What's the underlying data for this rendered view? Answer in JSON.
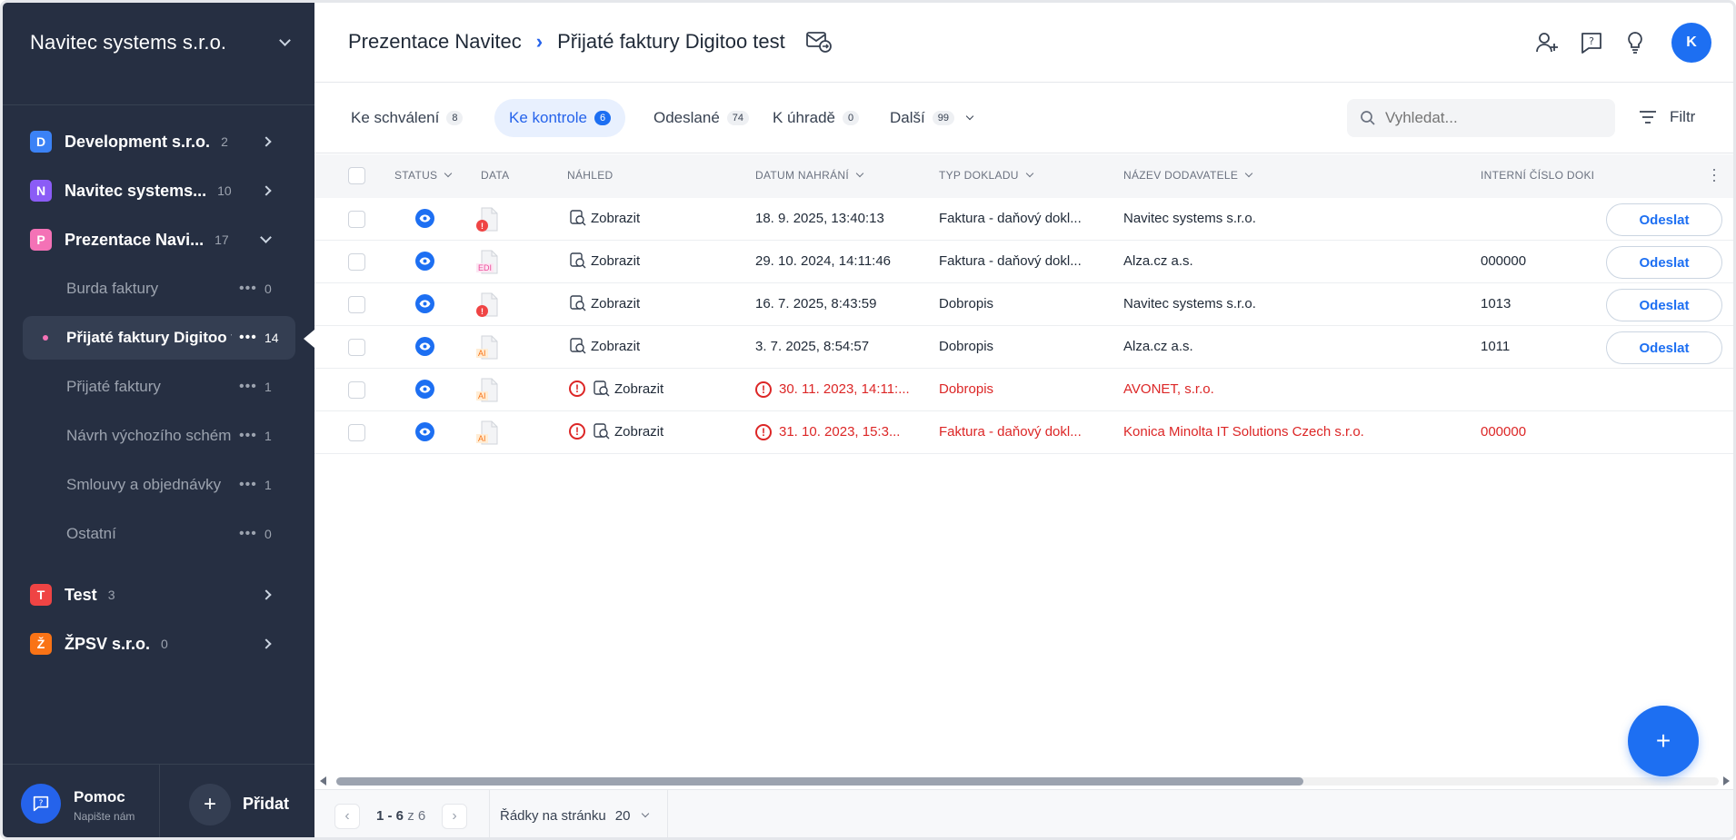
{
  "sidebar": {
    "org_name": "Navitec systems s.r.o.",
    "workspaces": [
      {
        "initial": "D",
        "name": "Development s.r.o.",
        "count": "2",
        "color": "#3b82f6"
      },
      {
        "initial": "N",
        "name": "Navitec systems...",
        "count": "10",
        "color": "#8b5cf6"
      },
      {
        "initial": "P",
        "name": "Prezentace Navi...",
        "count": "17",
        "color": "#f472b6"
      },
      {
        "initial": "T",
        "name": "Test",
        "count": "3",
        "color": "#ef4444"
      },
      {
        "initial": "Ž",
        "name": "ŽPSV s.r.o.",
        "count": "0",
        "color": "#f97316"
      }
    ],
    "subitems": [
      {
        "label": "Burda faktury",
        "count": "0"
      },
      {
        "label": "Přijaté faktury Digitoo test",
        "count": "14"
      },
      {
        "label": "Přijaté faktury",
        "count": "1"
      },
      {
        "label": "Návrh výchozího schéma",
        "count": "1"
      },
      {
        "label": "Smlouvy a objednávky",
        "count": "1"
      },
      {
        "label": "Ostatní",
        "count": "0"
      }
    ],
    "help_title": "Pomoc",
    "help_sub": "Napište nám",
    "add_label": "Přidat"
  },
  "header": {
    "crumb_parent": "Prezentace Navitec",
    "crumb_current": "Přijaté faktury Digitoo test",
    "avatar": "K"
  },
  "tabs": [
    {
      "label": "Ke schválení",
      "count": "8"
    },
    {
      "label": "Ke kontrole",
      "count": "6"
    },
    {
      "label": "Odeslané",
      "count": "74"
    },
    {
      "label": "K úhradě",
      "count": "0"
    },
    {
      "label": "Další",
      "count": "99"
    }
  ],
  "search": {
    "placeholder": "Vyhledat..."
  },
  "filter_label": "Filtr",
  "table": {
    "headers": {
      "status": "STATUS",
      "data": "DATA",
      "preview": "NÁHLED",
      "date": "DATUM NAHRÁNÍ",
      "type": "TYP DOKLADU",
      "supplier": "NÁZEV DODAVATELE",
      "internal": "INTERNÍ ČÍSLO DOKLADU"
    },
    "preview_label": "Zobrazit",
    "send_label": "Odeslat",
    "rows": [
      {
        "date": "18. 9. 2025, 13:40:13",
        "type": "Faktura - daňový dokl...",
        "supplier": "Navitec systems s.r.o.",
        "internal": "",
        "doc_tag": ""
      },
      {
        "date": "29. 10. 2024, 14:11:46",
        "type": "Faktura - daňový dokl...",
        "supplier": "Alza.cz a.s.",
        "internal": "000000",
        "doc_tag": "EDI"
      },
      {
        "date": "16. 7. 2025, 8:43:59",
        "type": "Dobropis",
        "supplier": "Navitec systems s.r.o.",
        "internal": "1013",
        "doc_tag": ""
      },
      {
        "date": "3. 7. 2025, 8:54:57",
        "type": "Dobropis",
        "supplier": "Alza.cz a.s.",
        "internal": "1011",
        "doc_tag": "AI"
      },
      {
        "date": "30. 11. 2023, 14:11:...",
        "type": "Dobropis",
        "supplier": "AVONET, s.r.o.",
        "internal": "",
        "doc_tag": "AI"
      },
      {
        "date": "31. 10. 2023, 15:3...",
        "type": "Faktura - daňový dokl...",
        "supplier": "Konica Minolta IT Solutions Czech s.r.o.",
        "internal": "000000",
        "doc_tag": "AI"
      }
    ]
  },
  "pager": {
    "range": "1 - 6",
    "of_label": "z 6",
    "rows_label": "Řádky na stránku",
    "rows_value": "20"
  },
  "colors": {
    "accent": "#1d6ff2",
    "sidebar": "#262f42",
    "error": "#dc2626"
  }
}
